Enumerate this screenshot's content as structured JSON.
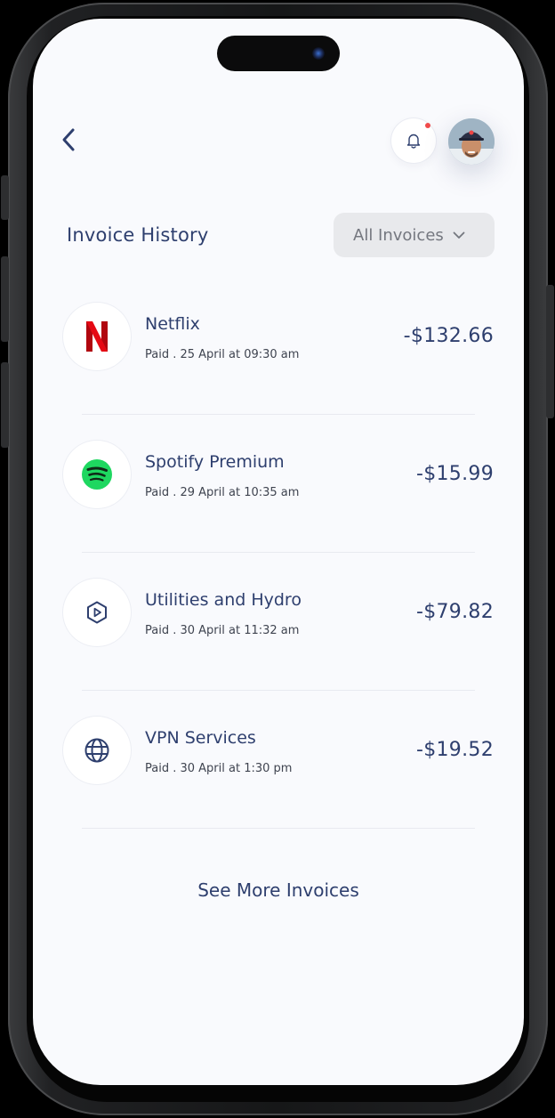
{
  "header": {
    "title": "Invoice History",
    "filter_label": "All Invoices",
    "notification_dot": true
  },
  "invoices": [
    {
      "name": "Netflix",
      "meta": "Paid . 25 April at 09:30 am",
      "amount": "-$132.66",
      "icon": "netflix-logo-icon"
    },
    {
      "name": "Spotify Premium",
      "meta": "Paid . 29 April at 10:35 am",
      "amount": "-$15.99",
      "icon": "spotify-logo-icon"
    },
    {
      "name": "Utilities and Hydro",
      "meta": "Paid . 30 April at 11:32 am",
      "amount": "-$79.82",
      "icon": "play-hexagon-icon"
    },
    {
      "name": "VPN Services",
      "meta": "Paid . 30 April at 1:30 pm",
      "amount": "-$19.52",
      "icon": "globe-icon"
    }
  ],
  "footer": {
    "see_more_label": "See More Invoices"
  },
  "colors": {
    "text_primary": "#2e3f6e",
    "screen_bg": "#f9fafd",
    "netflix_red": "#e50914",
    "spotify_green": "#1ed760",
    "notification": "#f04a4a"
  }
}
